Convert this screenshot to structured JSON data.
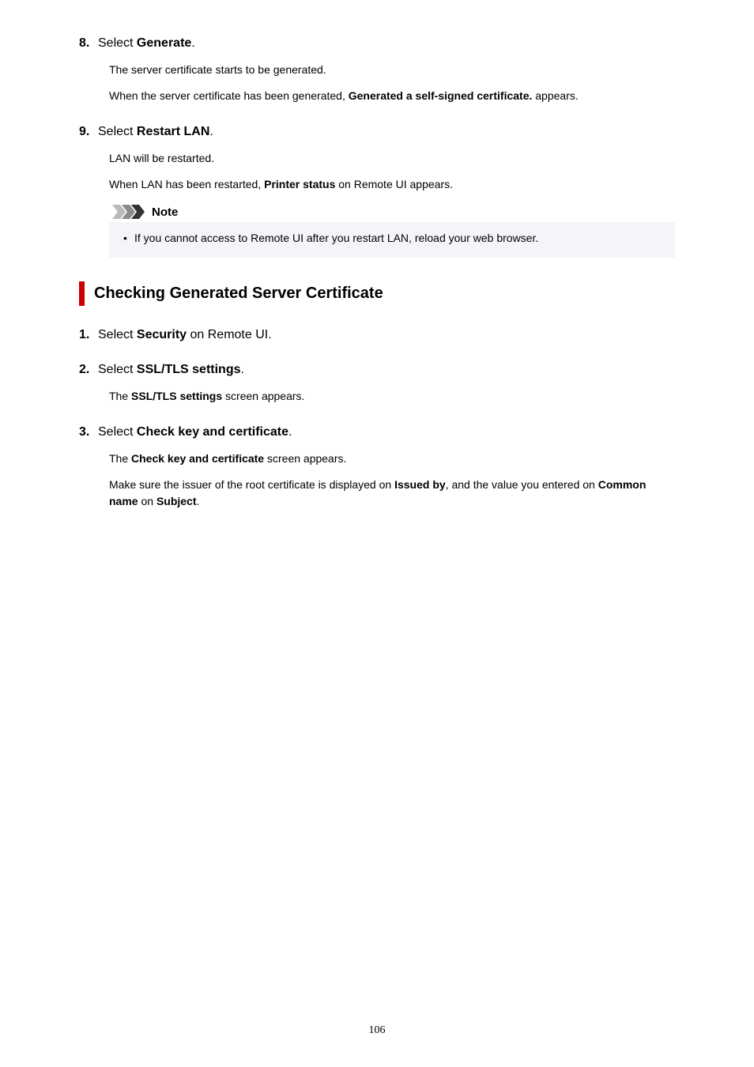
{
  "steps_a": [
    {
      "num": "8.",
      "title_pre": "Select ",
      "title_bold": "Generate",
      "title_post": ".",
      "body": [
        {
          "pre": "The server certificate starts to be generated."
        },
        {
          "pre": "When the server certificate has been generated, ",
          "bold": "Generated a self-signed certificate.",
          "post": " appears."
        }
      ]
    },
    {
      "num": "9.",
      "title_pre": "Select ",
      "title_bold": "Restart LAN",
      "title_post": ".",
      "body": [
        {
          "pre": "LAN will be restarted."
        },
        {
          "pre": "When LAN has been restarted, ",
          "bold": "Printer status",
          "post": " on Remote UI appears."
        }
      ]
    }
  ],
  "note": {
    "title": "Note",
    "item": "If you cannot access to Remote UI after you restart LAN, reload your web browser."
  },
  "section_heading": "Checking Generated Server Certificate",
  "steps_b": [
    {
      "num": "1.",
      "title_pre": "Select ",
      "title_bold": "Security",
      "title_post": " on Remote UI.",
      "body": []
    },
    {
      "num": "2.",
      "title_pre": "Select ",
      "title_bold": "SSL/TLS settings",
      "title_post": ".",
      "body": [
        {
          "pre": "The ",
          "bold": "SSL/TLS settings",
          "post": " screen appears."
        }
      ]
    },
    {
      "num": "3.",
      "title_pre": "Select ",
      "title_bold": "Check key and certificate",
      "title_post": ".",
      "body": [
        {
          "pre": "The ",
          "bold": "Check key and certificate",
          "post": " screen appears."
        },
        {
          "pre": "Make sure the issuer of the root certificate is displayed on ",
          "bold": "Issued by",
          "post": ", and the value you entered on ",
          "bold2": "Common name",
          "post2": " on ",
          "bold3": "Subject",
          "post3": "."
        }
      ]
    }
  ],
  "page_number": "106"
}
